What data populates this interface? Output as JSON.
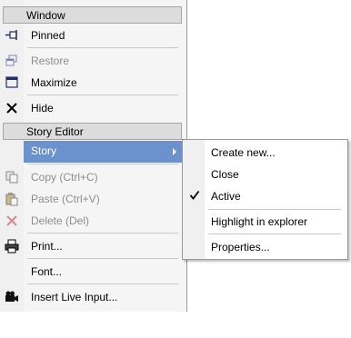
{
  "menu": {
    "window_header": "Window",
    "story_editor_header": "Story Editor",
    "items": {
      "pinned": "Pinned",
      "restore": "Restore",
      "maximize": "Maximize",
      "hide": "Hide",
      "story": "Story",
      "copy": "Copy (Ctrl+C)",
      "paste": "Paste (Ctrl+V)",
      "delete": "Delete (Del)",
      "print": "Print...",
      "font": "Font...",
      "insert_live_input": "Insert Live Input..."
    }
  },
  "submenu": {
    "create_new": "Create new...",
    "close": "Close",
    "active": "Active",
    "highlight_in_explorer": "Highlight in explorer",
    "properties": "Properties..."
  },
  "colors": {
    "highlight": "#6b92cc",
    "header_bg": "#dcdcdc",
    "disabled_text": "#8d8d8d"
  },
  "icons": {
    "pinned": "pin-icon",
    "restore": "restore-window-icon",
    "maximize": "maximize-window-icon",
    "hide": "close-x-icon",
    "copy": "copy-icon",
    "paste": "paste-icon",
    "delete": "delete-x-icon",
    "print": "printer-icon",
    "insert_live_input": "camera-icon",
    "active": "checkmark-icon"
  }
}
